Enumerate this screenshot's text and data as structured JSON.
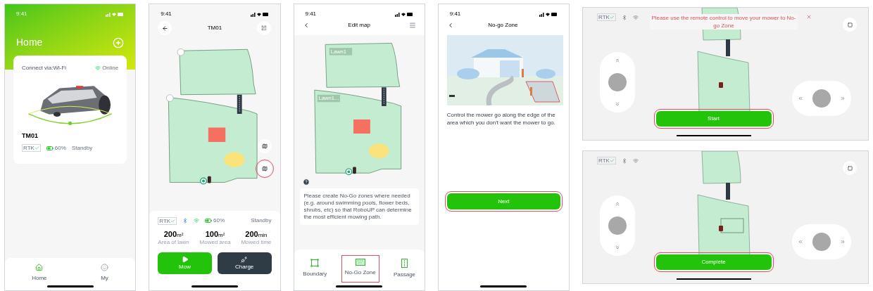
{
  "home_screen": {
    "time": "9:41",
    "title": "Home",
    "card": {
      "connection": "Connect via:Wi-Fi",
      "online": "Online",
      "name": "TM01",
      "rtk": "RTK",
      "battery": "60%",
      "state": "Standby"
    },
    "nav": [
      {
        "label": "Home",
        "selected": true
      },
      {
        "label": "My",
        "selected": false
      }
    ]
  },
  "device_screen": {
    "time": "9:41",
    "title": "TM01",
    "map_buttons": [
      {
        "highlighted": false
      },
      {
        "highlighted": true
      }
    ],
    "rtk": "RTK",
    "battery": "60%",
    "state": "Standby",
    "stats": [
      {
        "value": "200",
        "unit": "m²",
        "label": "Area of lawn"
      },
      {
        "value": "100",
        "unit": "m²",
        "label": "Mowed area"
      },
      {
        "value": "200",
        "unit": "min",
        "label": "Mowed time"
      }
    ],
    "actions": [
      {
        "label": "Mow",
        "kind": "mow"
      },
      {
        "label": "Charge",
        "kind": "charge"
      }
    ]
  },
  "edit_map_screen": {
    "time": "9:41",
    "title": "Edit map",
    "lawn_labels": [
      "Lawn1",
      "Lawn1..."
    ],
    "hint": "Please create No-Go zones where needed (e.g. around swimming pools, flower beds, shrubs, etc) so that  RoboUP can determine the most efficient mowing path.",
    "tools": [
      {
        "label": "Boundary",
        "kind": "boundary",
        "highlighted": false
      },
      {
        "label": "No-Go Zone",
        "kind": "nogo",
        "highlighted": true
      },
      {
        "label": "Passage",
        "kind": "passage",
        "highlighted": false
      }
    ]
  },
  "no_go_zone_screen": {
    "time": "9:41",
    "title": "No-go Zone",
    "instruction": "Control the mower go along the edge of the area which you don't want the mower to go.",
    "button": {
      "label": "Next",
      "highlighted": true
    }
  },
  "remote_screens": [
    {
      "rtk": "RTK",
      "message": "Please use the remote control to move your mower to No-go Zone",
      "zone_drawn": false,
      "button": {
        "label": "Start",
        "highlighted": true
      }
    },
    {
      "rtk": "RTK",
      "zone_drawn": true,
      "button": {
        "label": "Complete",
        "highlighted": true
      }
    }
  ]
}
